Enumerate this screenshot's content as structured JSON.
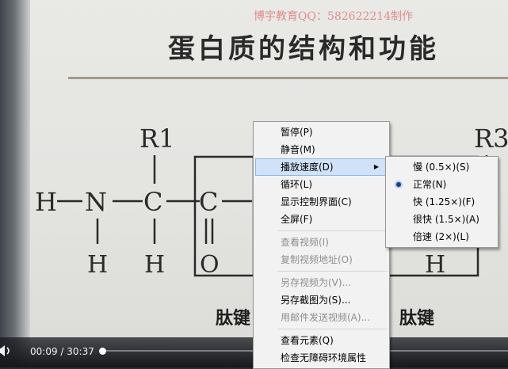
{
  "video": {
    "watermark": "博宇教育QQ：582622214制作",
    "slide_title": "蛋白质的结构和功能",
    "formula_atoms": [
      "R1",
      "R3",
      "H",
      "N",
      "C",
      "C",
      "H",
      "H",
      "O",
      "H"
    ],
    "bond_labels": [
      "肽键",
      "肽键"
    ]
  },
  "player": {
    "current_time": "00:09",
    "separator": " / ",
    "total_time": "30:37",
    "progress_fraction": 0.005
  },
  "context_menu": {
    "items": [
      {
        "label": "暂停(P)",
        "enabled": true
      },
      {
        "label": "静音(M)",
        "enabled": true
      },
      {
        "label": "播放速度(D)",
        "enabled": true,
        "submenu": true,
        "highlighted": true
      },
      {
        "label": "循环(L)",
        "enabled": true
      },
      {
        "label": "显示控制界面(C)",
        "enabled": true
      },
      {
        "label": "全屏(F)",
        "enabled": true
      },
      {
        "label": "查看视频(I)",
        "enabled": false
      },
      {
        "label": "复制视频地址(O)",
        "enabled": false
      },
      {
        "label": "另存视频为(V)...",
        "enabled": false
      },
      {
        "label": "另存截图为(S)...",
        "enabled": true
      },
      {
        "label": "用邮件发送视频(A)...",
        "enabled": false
      },
      {
        "label": "查看元素(Q)",
        "enabled": true
      },
      {
        "label": "检查无障碍环境属性",
        "enabled": true
      }
    ]
  },
  "speed_submenu": {
    "items": [
      {
        "label": "慢 (0.5×)(S)",
        "selected": false
      },
      {
        "label": "正常(N)",
        "selected": true
      },
      {
        "label": "快 (1.25×)(F)",
        "selected": false
      },
      {
        "label": "很快 (1.5×)(A)",
        "selected": false
      },
      {
        "label": "倍速 (2×)(L)",
        "selected": false
      }
    ]
  },
  "colors": {
    "menu_background": "#f2f2f2",
    "menu_highlight": "#cfe2f7",
    "disabled_text": "#8e8e8e",
    "watermark": "#e08d8d"
  }
}
